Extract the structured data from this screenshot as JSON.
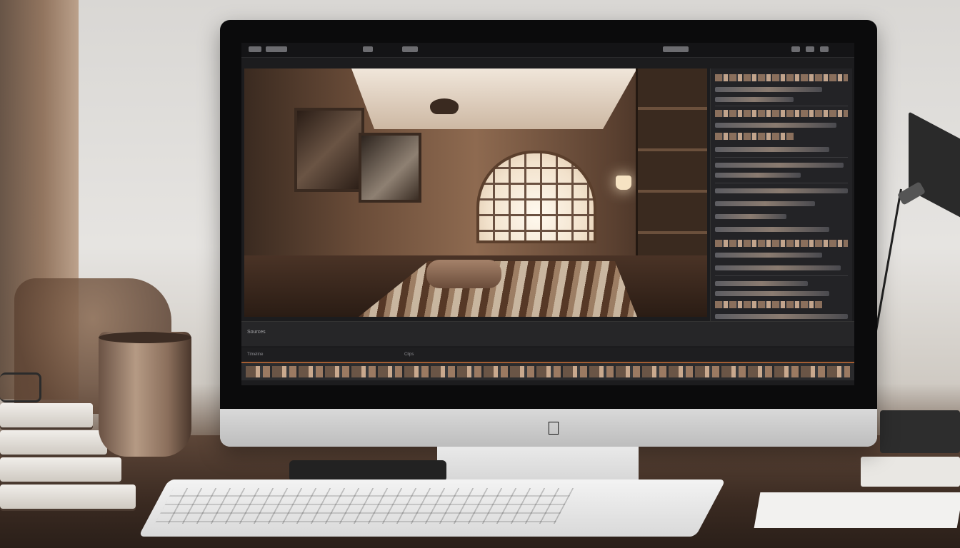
{
  "scene": {
    "description_objects": [
      "wall",
      "chair",
      "desk",
      "mug",
      "books",
      "glasses",
      "desk-lamp",
      "imac",
      "keyboard"
    ]
  },
  "screen": {
    "menubar_items": [
      "",
      "",
      ""
    ],
    "lower_label": "Sources",
    "lower2_labels": [
      "Timeline",
      "Clips"
    ]
  },
  "icons": {
    "apple": "apple-logo-icon"
  }
}
